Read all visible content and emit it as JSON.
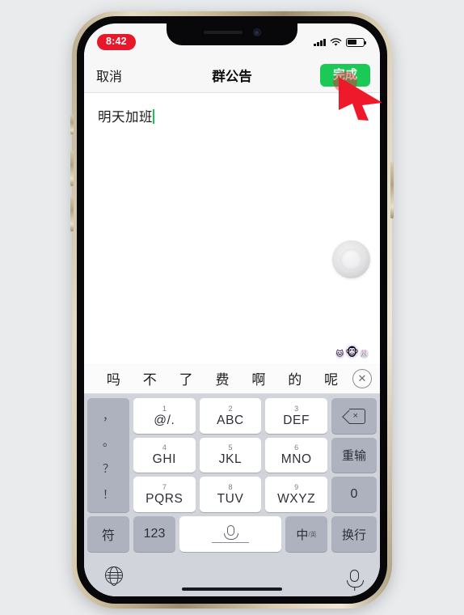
{
  "status_bar": {
    "time": "8:42",
    "signal_icon": "signal-bars-icon",
    "wifi_icon": "wifi-icon",
    "battery_icon": "battery-icon"
  },
  "nav_bar": {
    "cancel_label": "取消",
    "title": "群公告",
    "done_label": "完成",
    "done_color": "#1ac956"
  },
  "editor": {
    "text": "明天加班",
    "caret_color": "#18c256",
    "emoji_small_left": "🐱",
    "emoji_main": "🐵",
    "emoji_small_right": "🐰"
  },
  "assistive_touch": {
    "name": "assistive-touch-button"
  },
  "keyboard": {
    "candidates": [
      "吗",
      "不",
      "了",
      "费",
      "啊",
      "的",
      "呢"
    ],
    "close_icon": "✕",
    "punctuation": [
      "，",
      "。",
      "？",
      "！"
    ],
    "number_keys": [
      {
        "num": "1",
        "letters": "@/."
      },
      {
        "num": "2",
        "letters": "ABC"
      },
      {
        "num": "3",
        "letters": "DEF"
      },
      {
        "num": "4",
        "letters": "GHI"
      },
      {
        "num": "5",
        "letters": "JKL"
      },
      {
        "num": "6",
        "letters": "MNO"
      },
      {
        "num": "7",
        "letters": "PQRS"
      },
      {
        "num": "8",
        "letters": "TUV"
      },
      {
        "num": "9",
        "letters": "WXYZ"
      }
    ],
    "func_backspace": "delete-icon",
    "func_redo": "重输",
    "func_zero": "0",
    "bottom_row": {
      "symbols": "符",
      "numbers": "123",
      "space_icon": "microphone-icon",
      "lang_main": "中",
      "lang_sub": "/英",
      "enter": "换行"
    },
    "globe_icon": "globe-icon",
    "dictation_icon": "microphone-icon"
  },
  "annotation": {
    "pointer_color": "#ea2233",
    "pointer_name": "red-arrow-pointer"
  }
}
